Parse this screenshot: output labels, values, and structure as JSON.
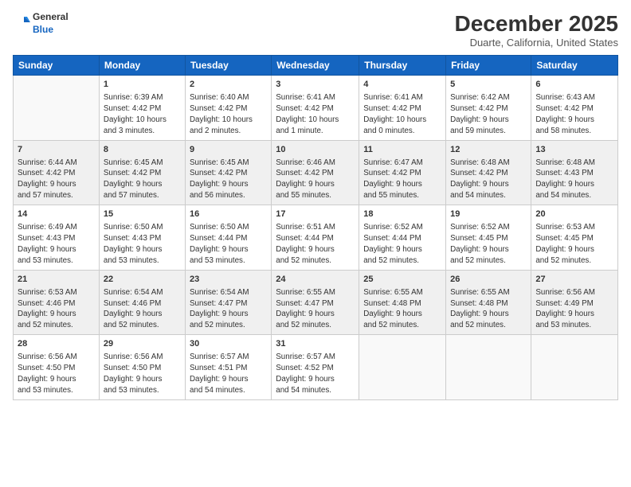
{
  "logo": {
    "line1": "General",
    "line2": "Blue"
  },
  "title": "December 2025",
  "location": "Duarte, California, United States",
  "days_header": [
    "Sunday",
    "Monday",
    "Tuesday",
    "Wednesday",
    "Thursday",
    "Friday",
    "Saturday"
  ],
  "weeks": [
    [
      {
        "day": "",
        "info": ""
      },
      {
        "day": "1",
        "info": "Sunrise: 6:39 AM\nSunset: 4:42 PM\nDaylight: 10 hours\nand 3 minutes."
      },
      {
        "day": "2",
        "info": "Sunrise: 6:40 AM\nSunset: 4:42 PM\nDaylight: 10 hours\nand 2 minutes."
      },
      {
        "day": "3",
        "info": "Sunrise: 6:41 AM\nSunset: 4:42 PM\nDaylight: 10 hours\nand 1 minute."
      },
      {
        "day": "4",
        "info": "Sunrise: 6:41 AM\nSunset: 4:42 PM\nDaylight: 10 hours\nand 0 minutes."
      },
      {
        "day": "5",
        "info": "Sunrise: 6:42 AM\nSunset: 4:42 PM\nDaylight: 9 hours\nand 59 minutes."
      },
      {
        "day": "6",
        "info": "Sunrise: 6:43 AM\nSunset: 4:42 PM\nDaylight: 9 hours\nand 58 minutes."
      }
    ],
    [
      {
        "day": "7",
        "info": "Sunrise: 6:44 AM\nSunset: 4:42 PM\nDaylight: 9 hours\nand 57 minutes."
      },
      {
        "day": "8",
        "info": "Sunrise: 6:45 AM\nSunset: 4:42 PM\nDaylight: 9 hours\nand 57 minutes."
      },
      {
        "day": "9",
        "info": "Sunrise: 6:45 AM\nSunset: 4:42 PM\nDaylight: 9 hours\nand 56 minutes."
      },
      {
        "day": "10",
        "info": "Sunrise: 6:46 AM\nSunset: 4:42 PM\nDaylight: 9 hours\nand 55 minutes."
      },
      {
        "day": "11",
        "info": "Sunrise: 6:47 AM\nSunset: 4:42 PM\nDaylight: 9 hours\nand 55 minutes."
      },
      {
        "day": "12",
        "info": "Sunrise: 6:48 AM\nSunset: 4:42 PM\nDaylight: 9 hours\nand 54 minutes."
      },
      {
        "day": "13",
        "info": "Sunrise: 6:48 AM\nSunset: 4:43 PM\nDaylight: 9 hours\nand 54 minutes."
      }
    ],
    [
      {
        "day": "14",
        "info": "Sunrise: 6:49 AM\nSunset: 4:43 PM\nDaylight: 9 hours\nand 53 minutes."
      },
      {
        "day": "15",
        "info": "Sunrise: 6:50 AM\nSunset: 4:43 PM\nDaylight: 9 hours\nand 53 minutes."
      },
      {
        "day": "16",
        "info": "Sunrise: 6:50 AM\nSunset: 4:44 PM\nDaylight: 9 hours\nand 53 minutes."
      },
      {
        "day": "17",
        "info": "Sunrise: 6:51 AM\nSunset: 4:44 PM\nDaylight: 9 hours\nand 52 minutes."
      },
      {
        "day": "18",
        "info": "Sunrise: 6:52 AM\nSunset: 4:44 PM\nDaylight: 9 hours\nand 52 minutes."
      },
      {
        "day": "19",
        "info": "Sunrise: 6:52 AM\nSunset: 4:45 PM\nDaylight: 9 hours\nand 52 minutes."
      },
      {
        "day": "20",
        "info": "Sunrise: 6:53 AM\nSunset: 4:45 PM\nDaylight: 9 hours\nand 52 minutes."
      }
    ],
    [
      {
        "day": "21",
        "info": "Sunrise: 6:53 AM\nSunset: 4:46 PM\nDaylight: 9 hours\nand 52 minutes."
      },
      {
        "day": "22",
        "info": "Sunrise: 6:54 AM\nSunset: 4:46 PM\nDaylight: 9 hours\nand 52 minutes."
      },
      {
        "day": "23",
        "info": "Sunrise: 6:54 AM\nSunset: 4:47 PM\nDaylight: 9 hours\nand 52 minutes."
      },
      {
        "day": "24",
        "info": "Sunrise: 6:55 AM\nSunset: 4:47 PM\nDaylight: 9 hours\nand 52 minutes."
      },
      {
        "day": "25",
        "info": "Sunrise: 6:55 AM\nSunset: 4:48 PM\nDaylight: 9 hours\nand 52 minutes."
      },
      {
        "day": "26",
        "info": "Sunrise: 6:55 AM\nSunset: 4:48 PM\nDaylight: 9 hours\nand 52 minutes."
      },
      {
        "day": "27",
        "info": "Sunrise: 6:56 AM\nSunset: 4:49 PM\nDaylight: 9 hours\nand 53 minutes."
      }
    ],
    [
      {
        "day": "28",
        "info": "Sunrise: 6:56 AM\nSunset: 4:50 PM\nDaylight: 9 hours\nand 53 minutes."
      },
      {
        "day": "29",
        "info": "Sunrise: 6:56 AM\nSunset: 4:50 PM\nDaylight: 9 hours\nand 53 minutes."
      },
      {
        "day": "30",
        "info": "Sunrise: 6:57 AM\nSunset: 4:51 PM\nDaylight: 9 hours\nand 54 minutes."
      },
      {
        "day": "31",
        "info": "Sunrise: 6:57 AM\nSunset: 4:52 PM\nDaylight: 9 hours\nand 54 minutes."
      },
      {
        "day": "",
        "info": ""
      },
      {
        "day": "",
        "info": ""
      },
      {
        "day": "",
        "info": ""
      }
    ]
  ]
}
